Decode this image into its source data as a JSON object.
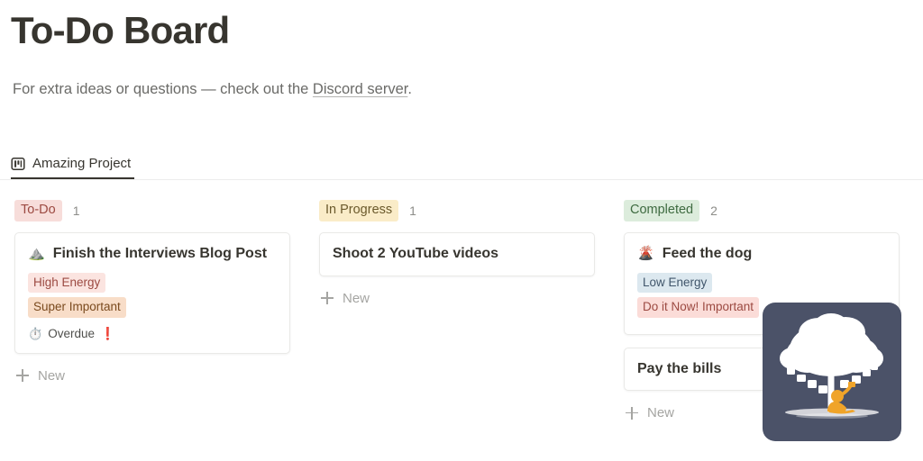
{
  "header": {
    "title": "To-Do Board",
    "subtitle_before": "For extra ideas or questions — check out the ",
    "subtitle_link": "Discord server",
    "subtitle_after": "."
  },
  "tabs": [
    {
      "label": "Amazing Project",
      "icon": "board-icon",
      "active": true
    }
  ],
  "board": {
    "columns": [
      {
        "name": "To-Do",
        "count": "1",
        "badge_bg": "#f7ddda",
        "badge_color": "#9c4a42",
        "new_label": "New",
        "cards": [
          {
            "emoji": "⛰️",
            "emoji_name": "mountain-emoji",
            "title": "Finish the Interviews Blog Post",
            "tags": [
              {
                "label": "High Energy",
                "bg": "#fbe4e0",
                "color": "#9c4a42"
              },
              {
                "label": "Super Important",
                "bg": "#f8ddc8",
                "color": "#7a4a1e"
              }
            ],
            "meta": {
              "emoji": "⏱️",
              "emoji_name": "stopwatch-emoji",
              "label": "Overdue",
              "flag": "❗"
            }
          }
        ]
      },
      {
        "name": "In Progress",
        "count": "1",
        "badge_bg": "#faecc8",
        "badge_color": "#6b5a2c",
        "new_label": "New",
        "cards": [
          {
            "emoji": "",
            "emoji_name": "",
            "title": "Shoot 2 YouTube videos",
            "tags": [],
            "meta": null
          }
        ]
      },
      {
        "name": "Completed",
        "count": "2",
        "badge_bg": "#dcecdc",
        "badge_color": "#3f6b41",
        "new_label": "New",
        "cards": [
          {
            "emoji": "🌋",
            "emoji_name": "volcano-emoji",
            "title": "Feed the dog",
            "tags": [
              {
                "label": "Low Energy",
                "bg": "#dce8ef",
                "color": "#41566b"
              },
              {
                "label": "Do it Now! Important",
                "bg": "#fbdcd8",
                "color": "#9c4a42"
              }
            ],
            "meta": null
          },
          {
            "emoji": "",
            "emoji_name": "",
            "title": "Pay the bills",
            "tags": [],
            "meta": null
          }
        ]
      }
    ]
  },
  "logo_badge": {
    "name": "tree-reader-logo",
    "background": "#4b5268",
    "tree_color": "#ffffff",
    "figure_color": "#f0a429"
  }
}
